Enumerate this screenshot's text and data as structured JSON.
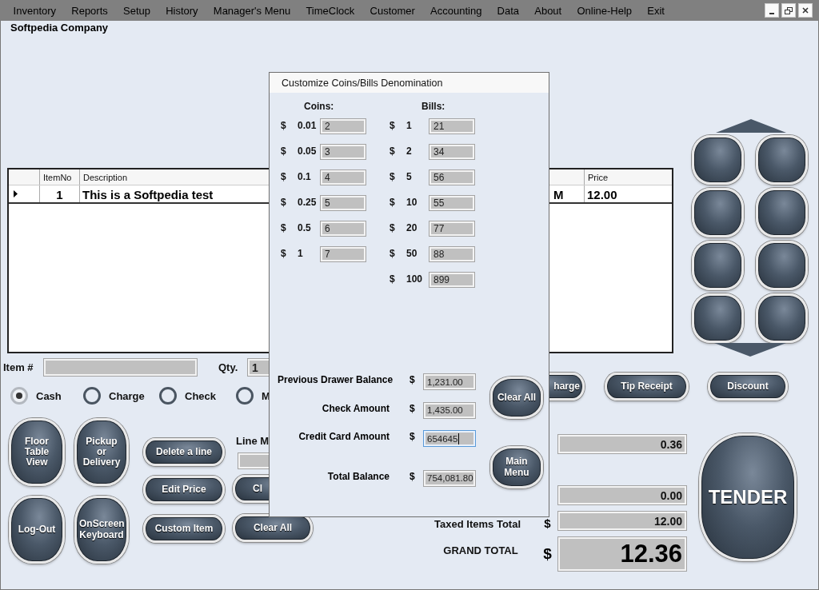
{
  "menu": [
    "Inventory",
    "Reports",
    "Setup",
    "History",
    "Manager's Menu",
    "TimeClock",
    "Customer",
    "Accounting",
    "Data",
    "About",
    "Online-Help",
    "Exit"
  ],
  "company": "Softpedia Company",
  "table": {
    "columns": [
      "ItemNo",
      "Description",
      "Price"
    ],
    "rows": [
      {
        "current": true,
        "item_no": "1",
        "description": "This is a Softpedia test",
        "column_3": "M",
        "price": "12.00"
      }
    ]
  },
  "item_field": {
    "label": "Item #"
  },
  "qty_field": {
    "label": "Qty.",
    "value": "1"
  },
  "payment_options": [
    {
      "label": "Cash",
      "selected": true
    },
    {
      "label": "Charge",
      "selected": false
    },
    {
      "label": "Check",
      "selected": false
    },
    {
      "label": "M",
      "selected": false
    }
  ],
  "large_buttons": [
    "Floor Table View",
    "Pickup or Delivery",
    "Log-Out",
    "OnScreen Keyboard"
  ],
  "line_buttons": [
    "Delete a line",
    "Edit Price",
    "Custom Item"
  ],
  "line_label": "Line M",
  "line_buttons_2": [
    "Cl",
    "Clear All"
  ],
  "action_buttons": [
    "harge",
    "Tip Receipt",
    "Discount"
  ],
  "totals": [
    {
      "kind": "plain",
      "value": "0.36"
    },
    {
      "kind": "plain",
      "value": "0.00"
    },
    {
      "kind": "plain",
      "label": "Taxed Items Total",
      "symbol": "$",
      "value": "12.00"
    },
    {
      "kind": "grand",
      "label": "GRAND TOTAL",
      "symbol": "$",
      "value": "12.36"
    }
  ],
  "tender": "TENDER",
  "dialog": {
    "title": "Customize Coins/Bills Denomination",
    "coins_heading": "Coins:",
    "bills_heading": "Bills:",
    "coins": [
      {
        "symbol": "$",
        "value": "0.01",
        "count": "2"
      },
      {
        "symbol": "$",
        "value": "0.05",
        "count": "3"
      },
      {
        "symbol": "$",
        "value": "0.1",
        "count": "4"
      },
      {
        "symbol": "$",
        "value": "0.25",
        "count": "5"
      },
      {
        "symbol": "$",
        "value": "0.5",
        "count": "6"
      },
      {
        "symbol": "$",
        "value": "1",
        "count": "7"
      }
    ],
    "bills": [
      {
        "symbol": "$",
        "value": "1",
        "count": "21"
      },
      {
        "symbol": "$",
        "value": "2",
        "count": "34"
      },
      {
        "symbol": "$",
        "value": "5",
        "count": "56"
      },
      {
        "symbol": "$",
        "value": "10",
        "count": "55"
      },
      {
        "symbol": "$",
        "value": "20",
        "count": "77"
      },
      {
        "symbol": "$",
        "value": "50",
        "count": "88"
      },
      {
        "symbol": "$",
        "value": "100",
        "count": "899"
      }
    ],
    "amounts": [
      {
        "label": "Previous Drawer Balance",
        "symbol": "$",
        "value": "1,231.00",
        "focused": false
      },
      {
        "label": "Check Amount",
        "symbol": "$",
        "value": "1,435.00",
        "focused": false
      },
      {
        "label": "Credit Card Amount",
        "symbol": "$",
        "value": "654645",
        "focused": true
      },
      {
        "label": "Total Balance",
        "symbol": "$",
        "value": "754,081.80",
        "focused": false
      }
    ],
    "buttons": [
      "Clear All",
      "Main Menu"
    ]
  }
}
